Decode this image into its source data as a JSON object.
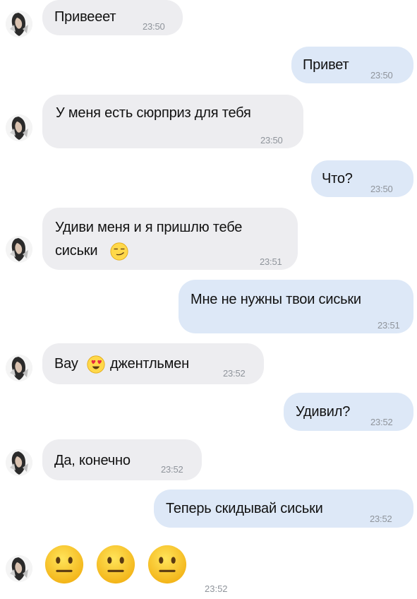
{
  "messages": [
    {
      "dir": "in",
      "text": "Привееет",
      "time": "23:50"
    },
    {
      "dir": "out",
      "text": "Привет",
      "time": "23:50"
    },
    {
      "dir": "in",
      "text": "У меня есть сюрприз для тебя",
      "time": "23:50"
    },
    {
      "dir": "out",
      "text": "Что?",
      "time": "23:50"
    },
    {
      "dir": "in",
      "text_line1": "Удиви меня и я пришлю тебе",
      "text_line2": "сиськи",
      "emoji": "smirking-face",
      "time": "23:51"
    },
    {
      "dir": "out",
      "text": "Мне не нужны твои сиськи",
      "time": "23:51"
    },
    {
      "dir": "in",
      "text_before": "Вау",
      "emoji": "heart-eyes-face",
      "text_after": "джентльмен",
      "time": "23:52"
    },
    {
      "dir": "out",
      "text": "Удивил?",
      "time": "23:52"
    },
    {
      "dir": "in",
      "text": "Да, конечно",
      "time": "23:52"
    },
    {
      "dir": "out",
      "text": "Теперь скидывай сиськи",
      "time": "23:52"
    },
    {
      "dir": "in",
      "emojis": [
        "neutral-face",
        "neutral-face",
        "neutral-face"
      ],
      "time": "23:52"
    }
  ]
}
